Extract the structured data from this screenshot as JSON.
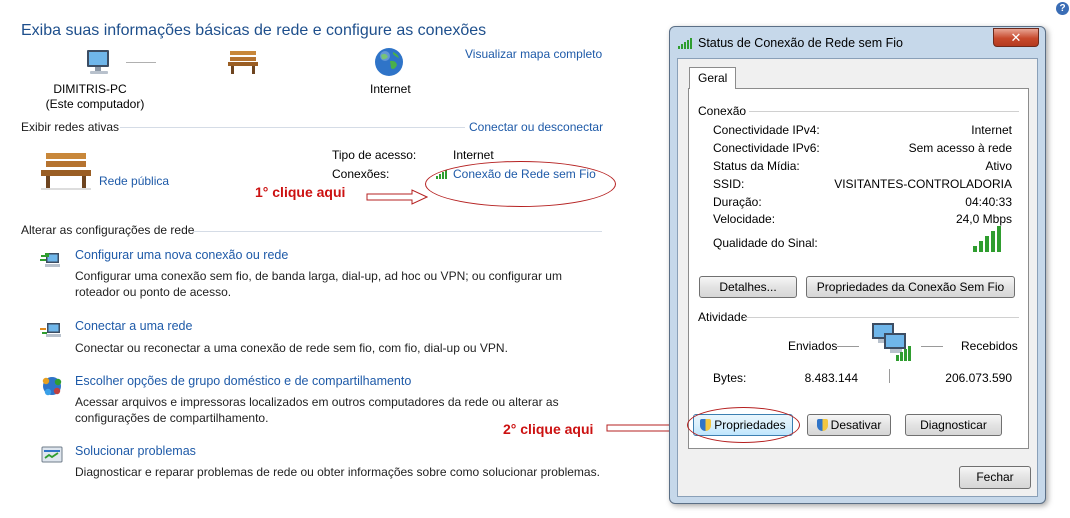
{
  "main": {
    "title": "Exiba suas informações básicas de rede e configure as conexões",
    "map_link": "Visualizar mapa completo",
    "computer_name": "DIMITRIS-PC",
    "computer_sub": "(Este computador)",
    "internet_label": "Internet",
    "active_networks_header": "Exibir redes ativas",
    "connect_link": "Conectar ou desconectar",
    "network_name": "Rede pública",
    "access_type_label": "Tipo de acesso:",
    "access_type_value": "Internet",
    "connections_label": "Conexões:",
    "connection_link": "Conexão de Rede sem Fio",
    "change_header": "Alterar as configurações de rede",
    "tasks": [
      {
        "title": "Configurar uma nova conexão ou rede",
        "desc": "Configurar uma conexão sem fio, de banda larga, dial-up, ad hoc ou VPN; ou configurar um roteador ou ponto de acesso."
      },
      {
        "title": "Conectar a uma rede",
        "desc": "Conectar ou reconectar a uma conexão de rede sem fio, com fio, dial-up ou VPN."
      },
      {
        "title": "Escolher opções de grupo doméstico e de compartilhamento",
        "desc": "Acessar arquivos e impressoras localizados em outros computadores da rede ou alterar as configurações de compartilhamento."
      },
      {
        "title": "Solucionar problemas",
        "desc": "Diagnosticar e reparar problemas de rede ou obter informações sobre como solucionar problemas."
      }
    ],
    "help_icon": "?"
  },
  "annotations": {
    "first": "1° clique aqui",
    "second": "2° clique aqui"
  },
  "dialog": {
    "title": "Status de Conexão de Rede sem Fio",
    "close": "✕",
    "tab": "Geral",
    "connection_group": "Conexão",
    "rows": [
      {
        "label": "Conectividade IPv4:",
        "value": "Internet"
      },
      {
        "label": "Conectividade IPv6:",
        "value": "Sem acesso à rede"
      },
      {
        "label": "Status da Mídia:",
        "value": "Ativo"
      },
      {
        "label": "SSID:",
        "value": "VISITANTES-CONTROLADORIA"
      },
      {
        "label": "Duração:",
        "value": "04:40:33"
      },
      {
        "label": "Velocidade:",
        "value": "24,0 Mbps"
      }
    ],
    "signal_label": "Qualidade do Sinal:",
    "details_button": "Detalhes...",
    "wireless_props_button": "Propriedades da Conexão Sem Fio",
    "activity_group": "Atividade",
    "sent_label": "Enviados",
    "received_label": "Recebidos",
    "bytes_label": "Bytes:",
    "bytes_sent": "8.483.144",
    "bytes_received": "206.073.590",
    "properties_button": "Propriedades",
    "disable_button": "Desativar",
    "diagnose_button": "Diagnosticar",
    "close_button": "Fechar"
  },
  "colors": {
    "link": "#1e5aa8",
    "annotation_red": "#cc1111",
    "signal_green": "#2f9d2f"
  }
}
